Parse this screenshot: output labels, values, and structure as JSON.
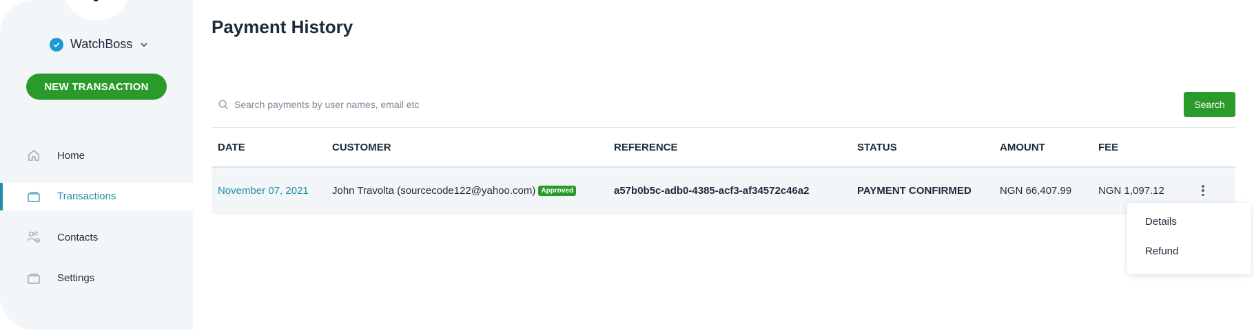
{
  "sidebar": {
    "org_name": "WatchBoss",
    "new_transaction_label": "NEW TRANSACTION",
    "items": [
      {
        "label": "Home",
        "icon": "home-icon",
        "active": false
      },
      {
        "label": "Transactions",
        "icon": "transactions-icon",
        "active": true
      },
      {
        "label": "Contacts",
        "icon": "contacts-icon",
        "active": false
      },
      {
        "label": "Settings",
        "icon": "settings-icon",
        "active": false
      }
    ]
  },
  "page": {
    "title": "Payment History"
  },
  "search": {
    "placeholder": "Search payments by user names, email etc",
    "value": "",
    "button_label": "Search"
  },
  "table": {
    "columns": [
      "DATE",
      "CUSTOMER",
      "REFERENCE",
      "STATUS",
      "AMOUNT",
      "FEE"
    ],
    "rows": [
      {
        "date": "November 07, 2021",
        "customer": "John Travolta (sourcecode122@yahoo.com)",
        "badge": "Approved",
        "reference": "a57b0b5c-adb0-4385-acf3-af34572c46a2",
        "status": "PAYMENT CONFIRMED",
        "amount": "NGN 66,407.99",
        "fee": "NGN 1,097.12"
      }
    ]
  },
  "row_menu": {
    "items": [
      "Details",
      "Refund"
    ]
  },
  "colors": {
    "accent_green": "#2a9b2a",
    "accent_teal": "#1d8fa8",
    "check_blue": "#1d9ad0"
  }
}
